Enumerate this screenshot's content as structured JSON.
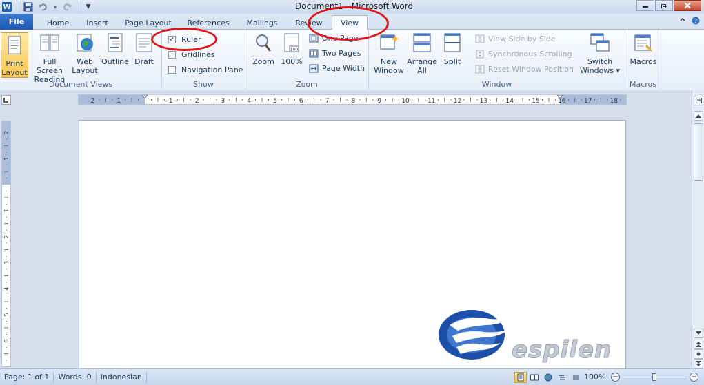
{
  "titlebar": {
    "title": "Document1 - Microsoft Word",
    "app_icon": "W"
  },
  "tabs": [
    {
      "label": "File"
    },
    {
      "label": "Home"
    },
    {
      "label": "Insert"
    },
    {
      "label": "Page Layout"
    },
    {
      "label": "References"
    },
    {
      "label": "Mailings"
    },
    {
      "label": "Review"
    },
    {
      "label": "View"
    }
  ],
  "ribbon": {
    "document_views": {
      "label": "Document Views",
      "print_layout": "Print\nLayout",
      "full_screen": "Full Screen\nReading",
      "web_layout": "Web\nLayout",
      "outline": "Outline",
      "draft": "Draft"
    },
    "show": {
      "label": "Show",
      "ruler": "Ruler",
      "gridlines": "Gridlines",
      "navigation_pane": "Navigation Pane"
    },
    "zoom": {
      "label": "Zoom",
      "zoom": "Zoom",
      "hundred": "100%",
      "one_page": "One Page",
      "two_pages": "Two Pages",
      "page_width": "Page Width"
    },
    "window": {
      "label": "Window",
      "new_window": "New\nWindow",
      "arrange_all": "Arrange\nAll",
      "split": "Split",
      "view_side_by_side": "View Side by Side",
      "sync_scrolling": "Synchronous Scrolling",
      "reset_position": "Reset Window Position",
      "switch_windows": "Switch\nWindows ▾"
    },
    "macros": {
      "label": "Macros",
      "macros": "Macros"
    }
  },
  "ruler": {
    "h_labels": [
      "2",
      "1",
      "1",
      "2",
      "3",
      "4",
      "5",
      "6",
      "7",
      "8",
      "9",
      "10",
      "11",
      "12",
      "13",
      "14",
      "15",
      "16",
      "17",
      "18"
    ],
    "v_labels": [
      "2",
      "1",
      "1",
      "2",
      "3",
      "4",
      "5",
      "6"
    ]
  },
  "statusbar": {
    "page": "Page: 1 of 1",
    "words": "Words: 0",
    "language": "Indonesian",
    "zoom": "100%"
  },
  "watermark": {
    "text": "espilen"
  },
  "colors": {
    "annotation": "#e0161b",
    "file_tab": "#1d58b0",
    "selected": "#f9c850"
  }
}
